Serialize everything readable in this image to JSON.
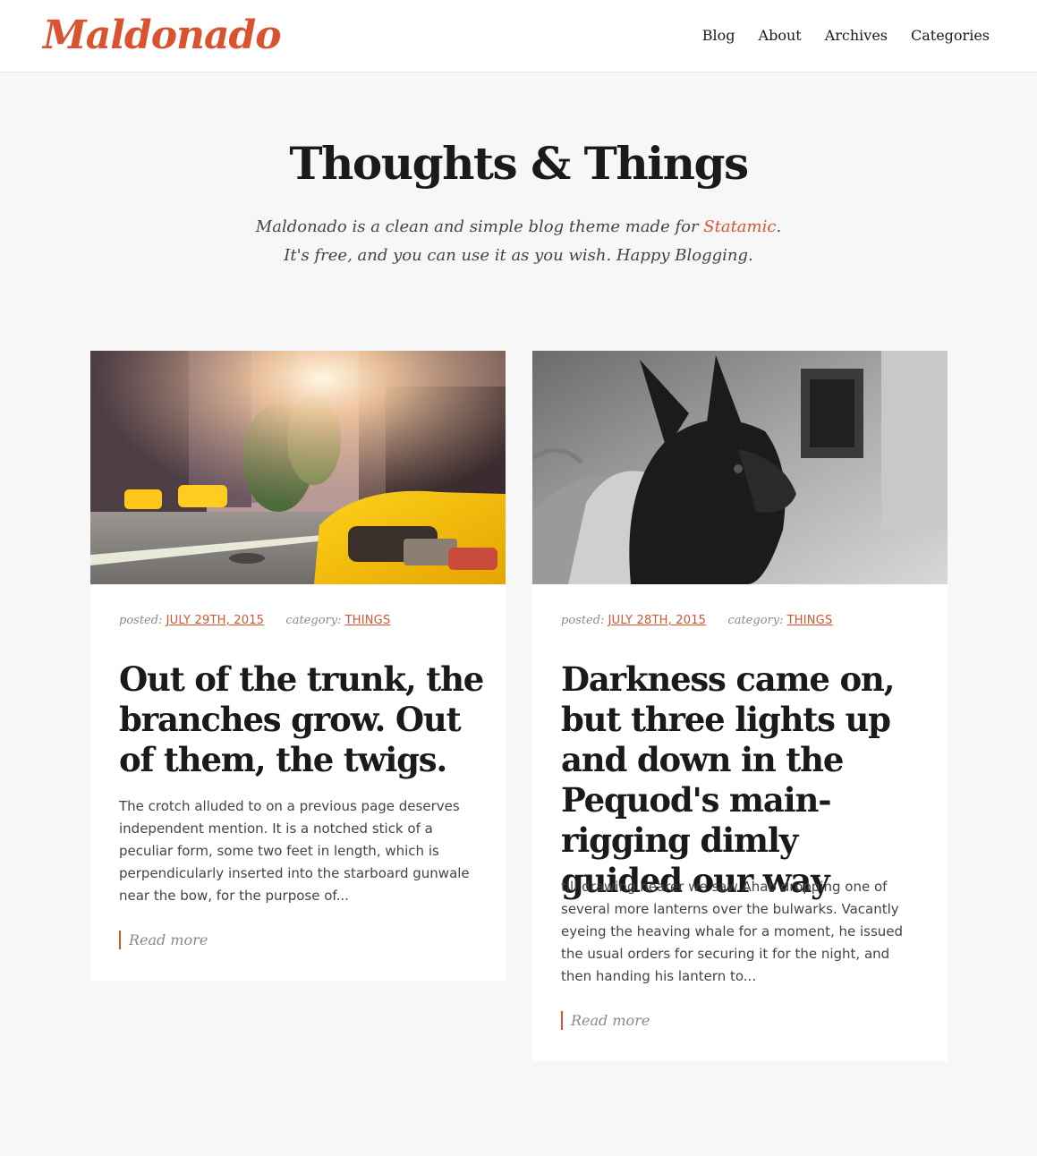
{
  "brand": {
    "logo_text": "Maldonado",
    "accent": "#d9532f"
  },
  "nav": {
    "items": [
      {
        "label": "Blog"
      },
      {
        "label": "About"
      },
      {
        "label": "Archives"
      },
      {
        "label": "Categories"
      }
    ]
  },
  "hero": {
    "title": "Thoughts & Things",
    "line1_before": "Maldonado is a clean and simple blog theme made for ",
    "line1_link": "Statamic",
    "line1_after": ".",
    "line2": "It's free, and you can use it as you wish. Happy Blogging."
  },
  "posts": [
    {
      "image": "taxi-street-photo",
      "posted_label": "posted:",
      "date": "JULY 29TH, 2015",
      "category_label": "category:",
      "category": "THINGS",
      "title": "Out of the trunk, the branches grow. Out of them, the twigs.",
      "excerpt": "The crotch alluded to on a previous page deserves independent mention. It is a notched stick of a peculiar form, some two feet in length, which is perpendicularly inserted into the starboard gunwale near the bow, for the purpose of...",
      "read_more": "Read more"
    },
    {
      "image": "french-bulldog-photo",
      "posted_label": "posted:",
      "date": "JULY 28TH, 2015",
      "category_label": "category:",
      "category": "THINGS",
      "title": "Darkness came on, but three lights up and down in the Pequod's main-rigging dimly guided our way",
      "excerpt": "till drawing nearer we saw Ahab dropping one of several more lanterns over the bulwarks. Vacantly eyeing the heaving whale for a moment, he issued the usual orders for securing it for the night, and then handing his lantern to...",
      "read_more": "Read more"
    }
  ]
}
